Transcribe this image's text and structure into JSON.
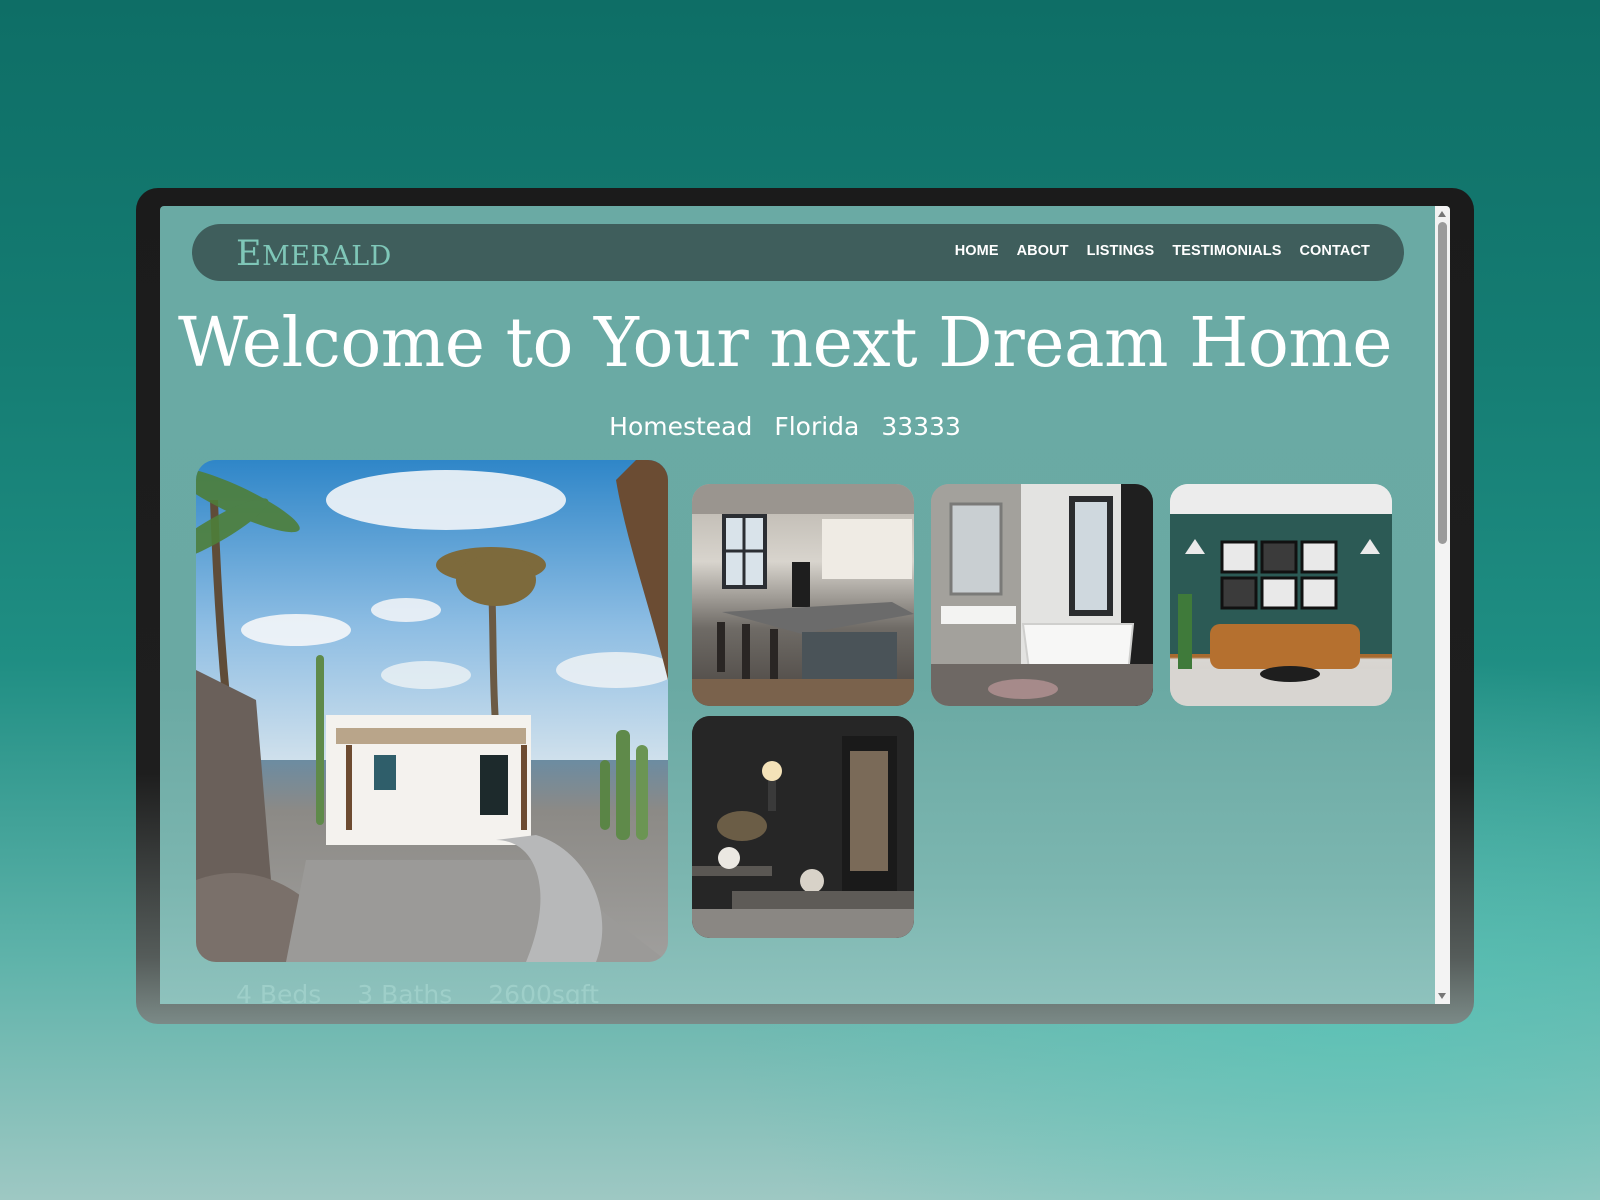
{
  "brand": {
    "logo": "Emerald",
    "logo_first": "E",
    "logo_rest": "MERALD"
  },
  "nav": {
    "items": [
      {
        "label": "HOME"
      },
      {
        "label": "ABOUT"
      },
      {
        "label": "LISTINGS"
      },
      {
        "label": "TESTIMONIALS"
      },
      {
        "label": "CONTACT"
      }
    ]
  },
  "hero": {
    "title": "Welcome to Your next Dream Home",
    "location": {
      "city": "Homestead",
      "state": "Florida",
      "zip": "33333"
    }
  },
  "property": {
    "beds": "4 Beds",
    "baths": "3 Baths",
    "area": "2600sqft"
  },
  "colors": {
    "accent": "#7fc7b8",
    "nav_bg": "#3f5e5c",
    "page_bg": "#6aaaa4"
  }
}
